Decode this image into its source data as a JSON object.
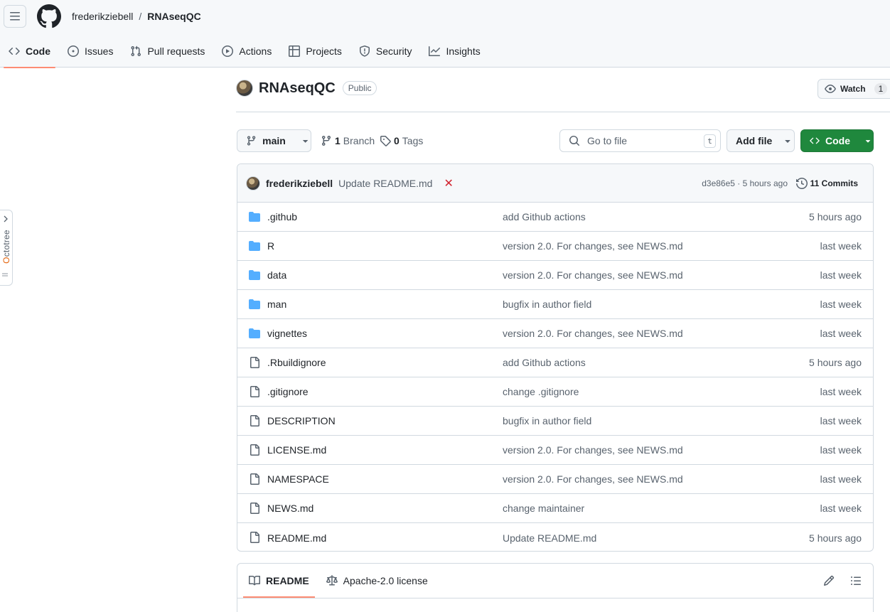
{
  "header": {
    "owner": "frederikziebell",
    "separator": "/",
    "repo": "RNAseqQC"
  },
  "tabs": [
    {
      "label": "Code",
      "icon": "code-icon",
      "selected": true
    },
    {
      "label": "Issues",
      "icon": "issue-icon"
    },
    {
      "label": "Pull requests",
      "icon": "pull-request-icon"
    },
    {
      "label": "Actions",
      "icon": "play-icon"
    },
    {
      "label": "Projects",
      "icon": "table-icon"
    },
    {
      "label": "Security",
      "icon": "shield-icon"
    },
    {
      "label": "Insights",
      "icon": "graph-icon"
    }
  ],
  "octotree": {
    "label_o": "O",
    "label_rest": "ctotree"
  },
  "repo": {
    "name": "RNAseqQC",
    "visibility": "Public",
    "watch_label": "Watch",
    "watch_count": "1"
  },
  "toolbar": {
    "branch": "main",
    "branches_count": "1",
    "branches_label": "Branch",
    "tags_count": "0",
    "tags_label": "Tags",
    "search_placeholder": "Go to file",
    "search_shortcut": "t",
    "add_file": "Add file",
    "code": "Code"
  },
  "latest_commit": {
    "author": "frederikziebell",
    "message": "Update README.md",
    "status": "✕",
    "hash_time": "d3e86e5 · 5 hours ago",
    "commits": "11 Commits"
  },
  "files": [
    {
      "type": "dir",
      "name": ".github",
      "message": "add Github actions",
      "age": "5 hours ago"
    },
    {
      "type": "dir",
      "name": "R",
      "message": "version 2.0. For changes, see NEWS.md",
      "age": "last week"
    },
    {
      "type": "dir",
      "name": "data",
      "message": "version 2.0. For changes, see NEWS.md",
      "age": "last week"
    },
    {
      "type": "dir",
      "name": "man",
      "message": "bugfix in author field",
      "age": "last week"
    },
    {
      "type": "dir",
      "name": "vignettes",
      "message": "version 2.0. For changes, see NEWS.md",
      "age": "last week"
    },
    {
      "type": "file",
      "name": ".Rbuildignore",
      "message": "add Github actions",
      "age": "5 hours ago"
    },
    {
      "type": "file",
      "name": ".gitignore",
      "message": "change .gitignore",
      "age": "last week"
    },
    {
      "type": "file",
      "name": "DESCRIPTION",
      "message": "bugfix in author field",
      "age": "last week"
    },
    {
      "type": "file",
      "name": "LICENSE.md",
      "message": "version 2.0. For changes, see NEWS.md",
      "age": "last week"
    },
    {
      "type": "file",
      "name": "NAMESPACE",
      "message": "version 2.0. For changes, see NEWS.md",
      "age": "last week"
    },
    {
      "type": "file",
      "name": "NEWS.md",
      "message": "change maintainer",
      "age": "last week"
    },
    {
      "type": "file",
      "name": "README.md",
      "message": "Update README.md",
      "age": "5 hours ago"
    }
  ],
  "readme": {
    "tab_readme": "README",
    "tab_license": "Apache-2.0 license"
  },
  "colors": {
    "accent_tab": "#fd8c73",
    "primary_button": "#1f883d",
    "folder": "#54aeff",
    "error": "#d1242f"
  }
}
